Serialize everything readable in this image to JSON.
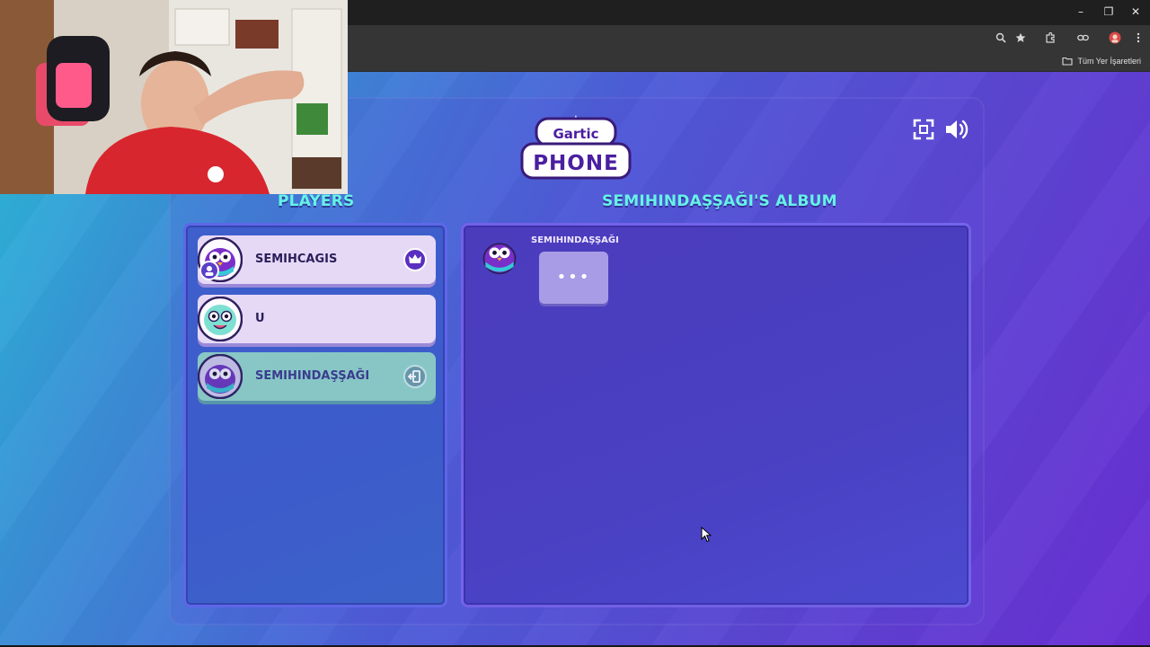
{
  "browser": {
    "window_controls": [
      "–",
      "❐",
      "✕"
    ],
    "bookmarks_folder_label": "Tüm Yer İşaretleri",
    "toolbar_icons": [
      "zoom-icon",
      "star-icon",
      "extensions-icon",
      "link-icon",
      "profile-icon",
      "menu-icon"
    ]
  },
  "game": {
    "logo_top": "Gartic",
    "logo_bottom": "PHONE",
    "players_heading": "PLAYERS",
    "album_heading": "SEMIHINDAŞŞAĞI'S ALBUM",
    "players": [
      {
        "name": "SEMIHCAGIS",
        "badge": "crown-icon",
        "style": "light"
      },
      {
        "name": "U",
        "badge": "",
        "style": "light"
      },
      {
        "name": "SEMIHINDAŞŞAĞI",
        "badge": "exit-icon",
        "style": "dim"
      }
    ],
    "album": {
      "author": "SEMIHINDAŞŞAĞI",
      "bubble": "•••"
    }
  },
  "colors": {
    "heading": "#66f2e6",
    "accent_purple": "#6b3fd9"
  }
}
